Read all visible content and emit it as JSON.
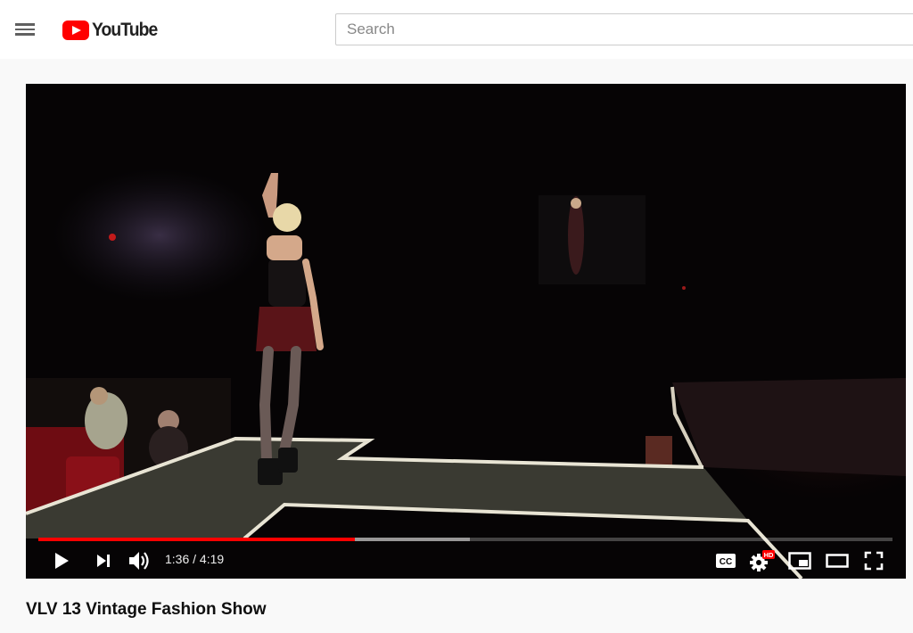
{
  "header": {
    "menu_icon": "hamburger-menu-icon",
    "logo_text": "YouTube",
    "brand_color": "#ff0000",
    "search_placeholder": "Search"
  },
  "player": {
    "time_display": "1:36 / 4:19",
    "played_fraction": 0.3707,
    "loaded_fraction": 0.505,
    "progress_color": "#ff0000",
    "controls": {
      "play_icon": "play-icon",
      "next_icon": "next-icon",
      "volume_icon": "volume-icon",
      "captions_icon": "captions-icon",
      "captions_label": "CC",
      "settings_icon": "settings-gear-icon",
      "hd_badge": "HD",
      "miniplayer_icon": "miniplayer-icon",
      "theater_icon": "theater-mode-icon",
      "fullscreen_icon": "fullscreen-icon"
    }
  },
  "video": {
    "title": "VLV 13 Vintage Fashion Show"
  }
}
